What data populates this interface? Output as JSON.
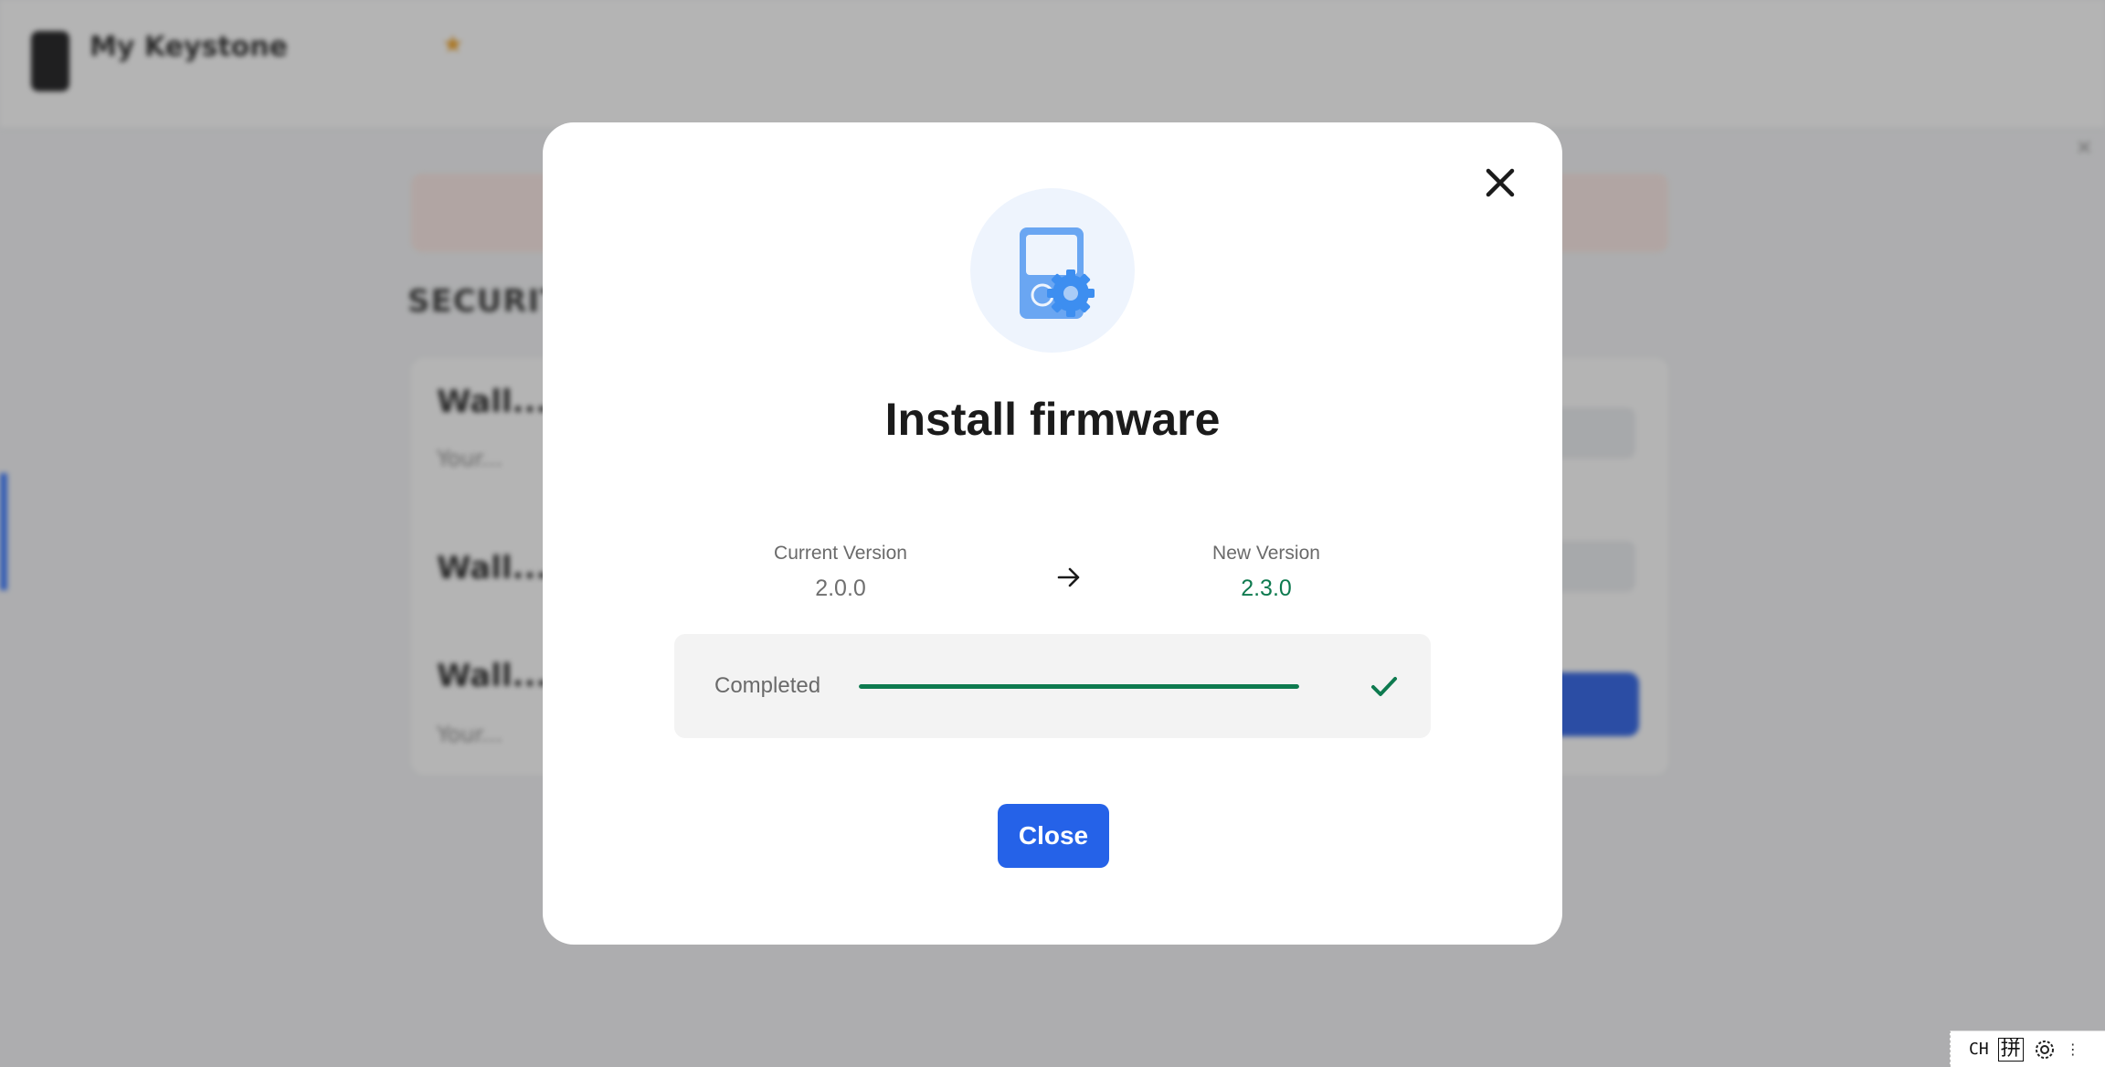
{
  "background_app": {
    "device_name": "My Keystone",
    "section_heading": "SECURITY",
    "rows": [
      {
        "title": "Wall...",
        "subtitle": "Your..."
      },
      {
        "title": "Wall...",
        "subtitle": ""
      },
      {
        "title": "Wall...",
        "subtitle": "Your..."
      }
    ]
  },
  "modal": {
    "title": "Install firmware",
    "current_version_label": "Current Version",
    "current_version": "2.0.0",
    "new_version_label": "New Version",
    "new_version": "2.3.0",
    "status_label": "Completed",
    "progress_percent": 100,
    "close_button_label": "Close",
    "icons": {
      "close": "close-icon",
      "hero": "firmware-device-icon",
      "arrow": "arrow-right-icon",
      "status": "checkmark-icon"
    },
    "colors": {
      "primary": "#2562e8",
      "success": "#0e7a4f",
      "hero_bg": "#eef4fd"
    }
  },
  "ime_tray": {
    "mode": "CH",
    "input_method": "拼"
  }
}
